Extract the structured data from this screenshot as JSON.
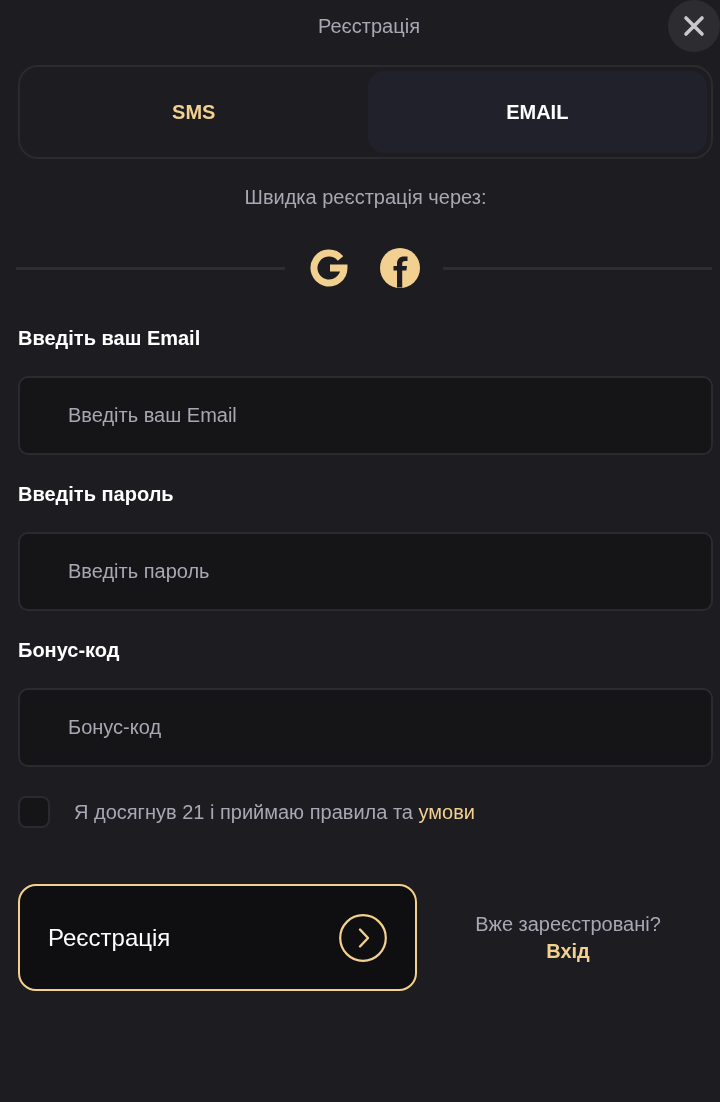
{
  "header": {
    "title": "Реєстрація"
  },
  "tabs": [
    {
      "label": "SMS",
      "selected": false
    },
    {
      "label": "EMAIL",
      "selected": true
    }
  ],
  "quick_signup": {
    "caption": "Швидка реєстрація через:"
  },
  "fields": [
    {
      "label": "Введіть ваш Email",
      "placeholder": "Введіть ваш Email"
    },
    {
      "label": "Введіть пароль",
      "placeholder": "Введіть пароль"
    },
    {
      "label": "Бонус-код",
      "placeholder": "Бонус-код"
    }
  ],
  "agreement": {
    "checked": false,
    "text": "Я досягнув 21 і приймаю правила та",
    "link": "умови"
  },
  "submit": {
    "label": "Реєстрація"
  },
  "login_prompt": {
    "text": "Вже зареєстровані?",
    "link": "Вхід"
  }
}
